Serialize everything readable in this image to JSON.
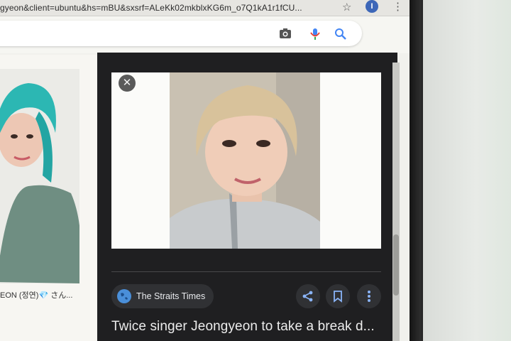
{
  "browser": {
    "url_text": "gyeon&client=ubuntu&hs=mBU&sxsrf=ALeKk02mkblxKG6m_o7Q1kA1r1fCU...",
    "profile_initial": "I"
  },
  "results": {
    "left_thumb_caption": "EON (정연)💎 さん..."
  },
  "viewer": {
    "close_symbol": "✕",
    "source_name": "The Straits Times",
    "title": "Twice singer Jeongyeon to take a break d..."
  },
  "colors": {
    "viewer_bg": "#1f1f21",
    "chip_bg": "#303134",
    "action_icon": "#8ab4f8",
    "brand_blue": "#4a8fd9"
  },
  "icons": [
    "star-icon",
    "camera-icon",
    "mic-icon",
    "search-icon",
    "close-icon",
    "globe-icon",
    "share-icon",
    "bookmark-icon",
    "more-vert-icon"
  ]
}
